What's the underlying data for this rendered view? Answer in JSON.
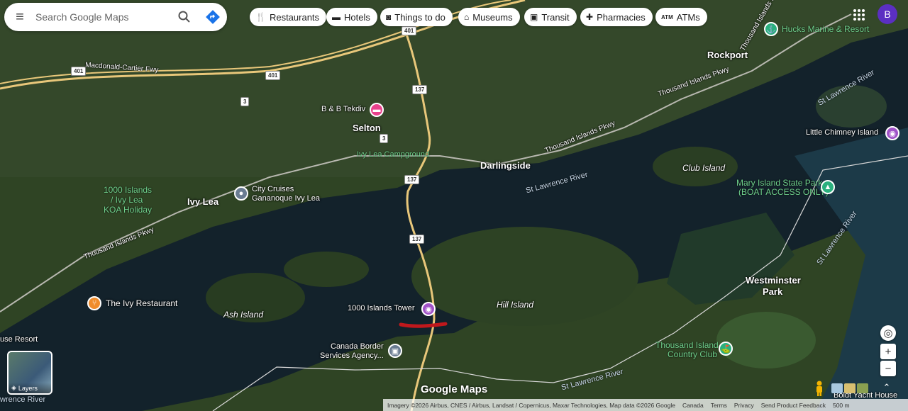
{
  "search": {
    "placeholder": "Search Google Maps"
  },
  "chips": [
    {
      "label": "Restaurants",
      "icon": "fork-knife-icon"
    },
    {
      "label": "Hotels",
      "icon": "bed-icon"
    },
    {
      "label": "Things to do",
      "icon": "camera-icon"
    },
    {
      "label": "Museums",
      "icon": "museum-icon"
    },
    {
      "label": "Transit",
      "icon": "train-icon"
    },
    {
      "label": "Pharmacies",
      "icon": "pharmacy-icon"
    },
    {
      "label": "ATMs",
      "icon": "atm-icon"
    }
  ],
  "account": {
    "initial": "B",
    "color": "#5b2fc2"
  },
  "places": {
    "hucks": "Hucks Marine & Resort",
    "rockport": "Rockport",
    "bb": "B & B Tekdiv",
    "selton": "Selton",
    "ivy_camp": "Ivy Lea Campground",
    "darlingside": "Darlingside",
    "little_chimney": "Little Chimney Island",
    "club_island": "Club Island",
    "mary_island": "Mary Island State Park",
    "mary_island_2": "(BOAT ACCESS ONLY)",
    "koa_1": "1000 Islands",
    "koa_2": "/ Ivy Lea",
    "koa_3": "KOA Holiday",
    "ivy_lea": "Ivy Lea",
    "city_cruises_1": "City Cruises",
    "city_cruises_2": "Gananoque Ivy Lea",
    "ivy_restaurant": "The Ivy Restaurant",
    "ash_island": "Ash Island",
    "tower": "1000 Islands Tower",
    "hill_island": "Hill Island",
    "border_1": "Canada Border",
    "border_2": "Services Agency...",
    "westminster_1": "Westminster",
    "westminster_2": "Park",
    "thousand_club_1": "Thousand Island",
    "thousand_club_2": "Country Club",
    "resort_partial": "use Resort",
    "river_partial": "wrence River",
    "yacht_partial": "Boldt Yacht House"
  },
  "roads": {
    "macdonald": "Macdonald-Cartier Fwy",
    "pkwy_1": "Thousand Islands Pkwy",
    "pkwy_2": "Thousand Islands Pkwy",
    "pkwy_3": "Thousand Islands Pkwy",
    "pkwy_4": "Thousand Islands Pkwy",
    "river_1": "St Lawrence River",
    "river_2": "St Lawrence River",
    "river_3": "St Lawrence River",
    "river_4": "St Lawrence River",
    "hw401a": "401",
    "hw401b": "401",
    "hw401c": "401",
    "hw137a": "137",
    "hw137b": "137",
    "hw137c": "137",
    "hw3a": "3",
    "hw3b": "3"
  },
  "controls": {
    "layers_label": "Layers",
    "zoom_in": "+",
    "zoom_out": "−",
    "logo": "Google Maps",
    "scale": "500 m"
  },
  "attribution": {
    "imagery": "Imagery ©2026 Airbus, CNES / Airbus, Landsat / Copernicus, Maxar Technologies, Map data ©2026 Google",
    "country": "Canada",
    "terms": "Terms",
    "privacy": "Privacy",
    "feedback": "Send Product Feedback"
  },
  "colors": {
    "forest": "#2c3f22",
    "water": "#0f1f2a",
    "road": "#e8c77a",
    "route_mark": "#c0181c",
    "pin_pink": "#e8418c",
    "pin_purple": "#a052c8",
    "pin_teal": "#2bb07e",
    "pin_orange": "#f08c2a",
    "pin_slate": "#6a7c92"
  }
}
